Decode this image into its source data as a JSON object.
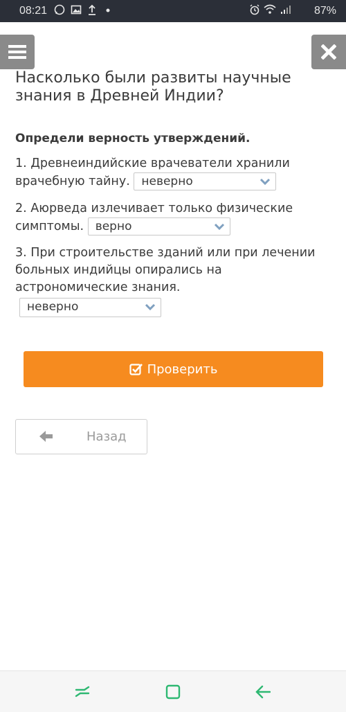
{
  "status_bar": {
    "time": "08:21",
    "battery": "87%",
    "icons": [
      "whatsapp-icon",
      "image-icon",
      "upload-icon",
      "dot-icon",
      "alarm-icon",
      "wifi-icon",
      "signal-icon"
    ]
  },
  "header": {
    "menu_icon": "hamburger-icon",
    "close_icon": "close-icon"
  },
  "question": {
    "title": "Насколько были развиты научные знания в Древней Индии?",
    "instruction": "Определи верность утверждений."
  },
  "statements": [
    {
      "text": "1. Древнеиндийские врачеватели хранили врачебную тайну.",
      "selected": "неверно"
    },
    {
      "text": "2. Аюрведа излечивает только физические симптомы.",
      "selected": "верно"
    },
    {
      "text": "3. При строительстве зданий или при лечении больных индийцы опирались на астрономические знания.",
      "selected": "неверно"
    }
  ],
  "actions": {
    "check_label": "Проверить",
    "back_label": "Назад"
  },
  "colors": {
    "accent": "#f68b1f",
    "header_button": "#8a8a8a",
    "status_bar": "#2b2f38",
    "dropdown_arrow": "#7fa0c0",
    "nav_icon": "#2eb872"
  }
}
